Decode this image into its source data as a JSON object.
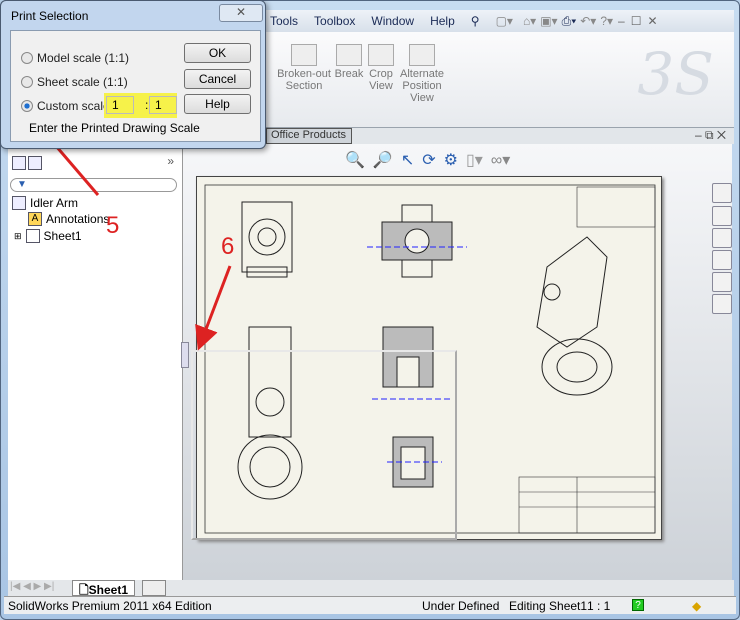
{
  "menu": {
    "items": [
      "Tools",
      "Toolbox",
      "Window",
      "Help"
    ]
  },
  "ribbon": {
    "buttons": [
      {
        "label": "Broken-out Section"
      },
      {
        "label": "Break"
      },
      {
        "label": "Crop View"
      },
      {
        "label": "Alternate Position View"
      }
    ],
    "logo": "DS"
  },
  "tabs": {
    "office_products": "Office Products"
  },
  "dialog": {
    "title": "Print Selection",
    "options": [
      "Model scale (1:1)",
      "Sheet scale (1:1)",
      "Custom scale"
    ],
    "selected": "Custom scale",
    "scale_num": "1",
    "scale_sep": ":",
    "scale_den": "1",
    "hint": "Enter the Printed Drawing Scale",
    "ok": "OK",
    "cancel": "Cancel",
    "help": "Help",
    "highlight_color": "#f6f24a"
  },
  "tree": {
    "root": "Idler Arm",
    "items": [
      "Annotations",
      "Sheet1"
    ]
  },
  "annotations": {
    "step5": "5",
    "step6": "6",
    "arrow_color": "#d22222"
  },
  "sheet_tabs": {
    "active": "Sheet1"
  },
  "status": {
    "edition": "SolidWorks Premium 2011 x64 Edition",
    "state": "Under Defined",
    "editing": "Editing Sheet1",
    "scale": "1 : 1"
  }
}
